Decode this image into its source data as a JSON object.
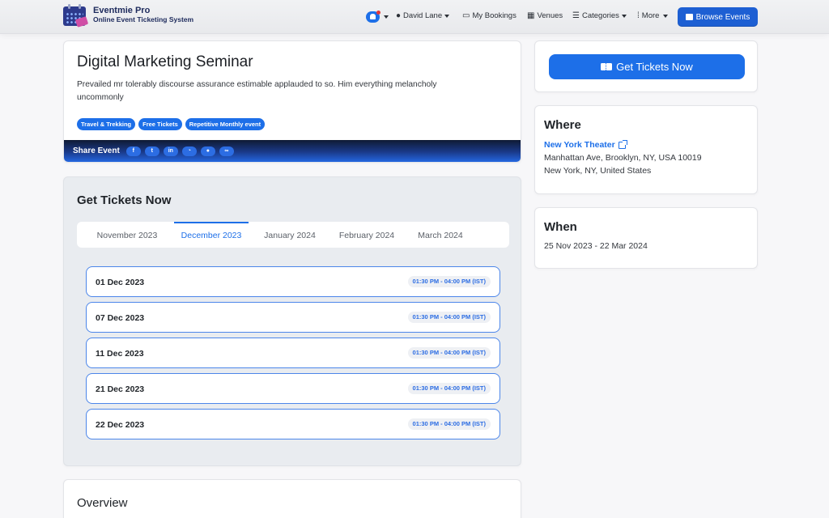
{
  "header": {
    "brand_name": "Eventmie Pro",
    "brand_sub": "Online Event Ticketing System",
    "user_name": "David Lane",
    "nav": {
      "my_bookings": "My Bookings",
      "venues": "Venues",
      "categories": "Categories",
      "more": "More"
    },
    "browse_events": "Browse Events",
    "accent": "#1d6fe8"
  },
  "event": {
    "title": "Digital Marketing Seminar",
    "description": "Prevailed mr tolerably discourse assurance estimable applauded to so. Him everything melancholy uncommonly",
    "tags": [
      "Travel & Trekking",
      "Free Tickets",
      "Repetitive Monthly event"
    ],
    "share_label": "Share Event",
    "share_icons": [
      "facebook-icon",
      "twitter-icon",
      "linkedin-icon",
      "whatsapp-icon",
      "reddit-icon",
      "link-icon"
    ]
  },
  "tickets": {
    "title": "Get Tickets Now",
    "months": [
      "November 2023",
      "December 2023",
      "January 2024",
      "February 2024",
      "March 2024"
    ],
    "active_month": "December 2023",
    "dates": [
      {
        "date": "01 Dec 2023",
        "time": "01:30 PM - 04:00 PM (IST)"
      },
      {
        "date": "07 Dec 2023",
        "time": "01:30 PM - 04:00 PM (IST)"
      },
      {
        "date": "11 Dec 2023",
        "time": "01:30 PM - 04:00 PM (IST)"
      },
      {
        "date": "21 Dec 2023",
        "time": "01:30 PM - 04:00 PM (IST)"
      },
      {
        "date": "22 Dec 2023",
        "time": "01:30 PM - 04:00 PM (IST)"
      }
    ]
  },
  "overview": {
    "title": "Overview"
  },
  "sidebar": {
    "cta_label": "Get Tickets Now",
    "where": {
      "title": "Where",
      "venue": "New York Theater",
      "address_line1": "Manhattan Ave, Brooklyn, NY, USA 10019",
      "address_line2": "New York, NY, United States"
    },
    "when": {
      "title": "When",
      "range": "25 Nov 2023 - 22 Mar 2024"
    }
  }
}
